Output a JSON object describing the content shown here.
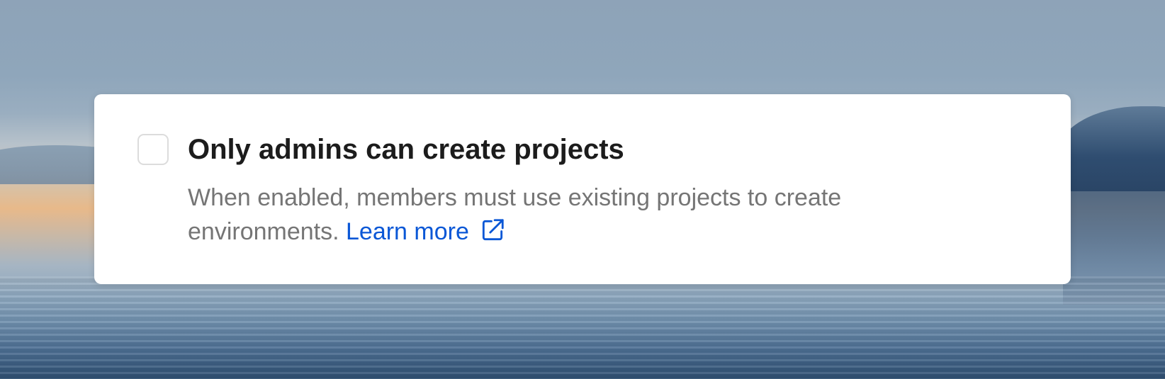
{
  "setting": {
    "checked": false,
    "title": "Only admins can create projects",
    "description": "When enabled, members must use existing projects to create environments.",
    "link_label": "Learn more",
    "link_icon": "external-link-icon"
  },
  "colors": {
    "title": "#1c1c1c",
    "description": "#757575",
    "link": "#0a57d6",
    "checkbox_border": "#dcdcdc"
  }
}
